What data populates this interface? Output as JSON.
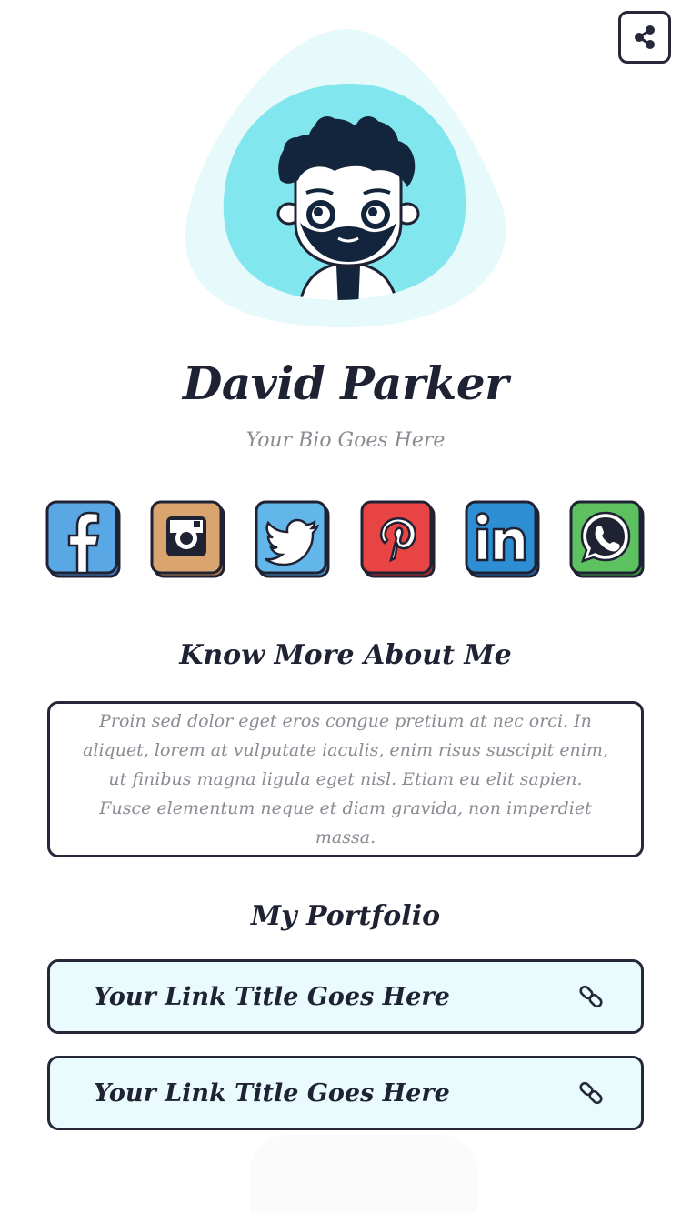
{
  "header": {
    "share_icon": "share-icon"
  },
  "profile": {
    "name": "David Parker",
    "bio": "Your Bio Goes Here",
    "avatar_icon": "cartoon-avatar",
    "colors": {
      "blob_outer": "#e6f9fb",
      "blob_inner": "#82e6ee",
      "ink": "#1f2233"
    }
  },
  "socials": [
    {
      "icon": "facebook-icon",
      "color": "#5aa7e6"
    },
    {
      "icon": "instagram-icon",
      "color": "#d9a46d"
    },
    {
      "icon": "twitter-icon",
      "color": "#63b6ea"
    },
    {
      "icon": "pinterest-icon",
      "color": "#e84444"
    },
    {
      "icon": "linkedin-icon",
      "color": "#2d8ed4"
    },
    {
      "icon": "whatsapp-icon",
      "color": "#5dc160"
    }
  ],
  "about": {
    "title": "Know More About Me",
    "text": "Proin sed dolor eget eros congue pretium at nec orci. In aliquet, lorem at vulputate iaculis, enim risus suscipit enim, ut finibus magna ligula eget nisl. Etiam eu elit sapien. Fusce elementum neque et diam gravida, non imperdiet massa."
  },
  "portfolio": {
    "title": "My Portfolio",
    "links": [
      {
        "title": "Your Link Title Goes Here",
        "icon": "link-icon"
      },
      {
        "title": "Your Link Title Goes Here",
        "icon": "link-icon"
      }
    ],
    "box_color": "#eafbfd"
  }
}
